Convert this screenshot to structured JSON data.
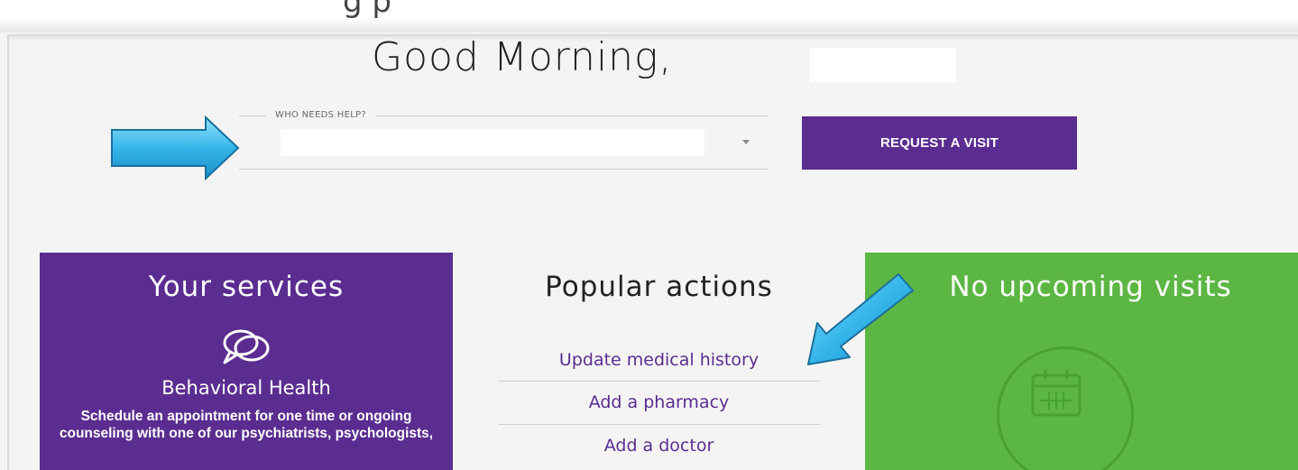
{
  "header": {
    "greeting": "Good Morning,"
  },
  "who_field": {
    "legend": "WHO NEEDS HELP?",
    "value": ""
  },
  "request_button": {
    "label": "REQUEST A VISIT"
  },
  "services_card": {
    "title": "Your services",
    "icon": "speech-bubbles-icon",
    "service_name": "Behavioral Health",
    "description": "Schedule an appointment for one time or ongoing counseling with one of our psychiatrists, psychologists,"
  },
  "popular_card": {
    "title": "Popular actions",
    "actions": [
      {
        "label": "Update medical history"
      },
      {
        "label": "Add a pharmacy"
      },
      {
        "label": "Add a doctor"
      }
    ]
  },
  "visits_card": {
    "title": "No upcoming visits",
    "icon": "calendar-icon"
  },
  "colors": {
    "brand_purple": "#5b2d90",
    "visits_green": "#5cb643",
    "annotation_arrow": "#35b6ea"
  }
}
